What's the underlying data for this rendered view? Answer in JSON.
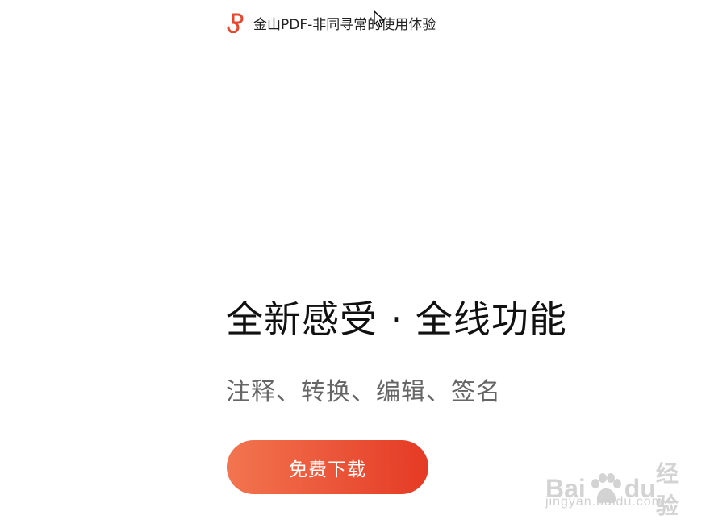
{
  "brand": {
    "logo_icon": "kingsoft-pdf-logo-icon",
    "title": "金山PDF-非同寻常的使用体验",
    "accent_color": "#e5472f"
  },
  "hero": {
    "title": "全新感受 · 全线功能",
    "subtitle": "注释、转换、编辑、签名"
  },
  "cta": {
    "download_label": "免费下载",
    "gradient_start": "#f27550",
    "gradient_end": "#e53a25"
  },
  "watermark": {
    "brand_text": "Bai",
    "brand_text_2": "du",
    "suffix": "经验",
    "url": "jingyan.baidu.com"
  }
}
